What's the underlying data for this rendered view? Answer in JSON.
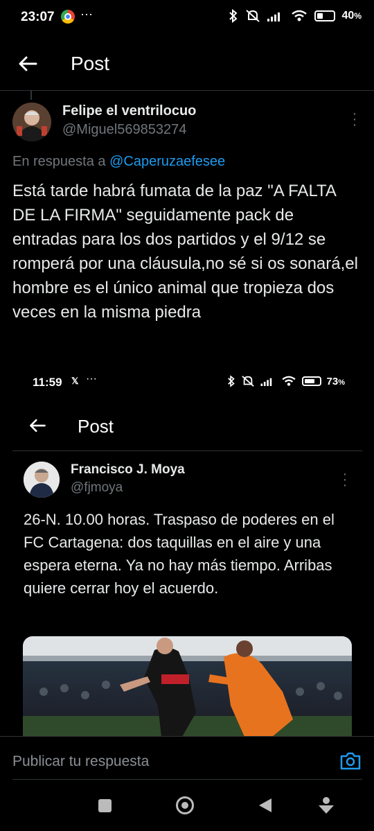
{
  "status_bar": {
    "time": "23:07",
    "battery": "40",
    "battery_fill": 0.4
  },
  "header": {
    "title": "Post"
  },
  "tweet": {
    "name": "Felipe el ventrilocuo",
    "handle": "@Miguel569853274",
    "reply_prefix": "En respuesta a",
    "reply_to": "@Caperuzaefesee",
    "text": "Está tarde habrá fumata de la paz \"A FALTA DE LA FIRMA\" seguidamente pack de entradas para los dos partidos y el 9/12 se romperá por una cláusula,no sé si os sonará,el hombre es el único animal que tropieza dos veces en la misma piedra"
  },
  "embedded_screenshot": {
    "status_bar": {
      "time": "11:59",
      "battery": "73",
      "battery_fill": 0.73
    },
    "header": {
      "title": "Post"
    },
    "tweet": {
      "name": "Francisco J. Moya",
      "handle": "@fjmoya",
      "text": "26-N. 10.00 horas. Traspaso de poderes en el FC Cartagena: dos taquillas en el aire y una espera eterna. Ya no hay más tiempo. Arribas quiere cerrar hoy el acuerdo."
    }
  },
  "reply_bar": {
    "placeholder": "Publicar tu respuesta"
  },
  "colors": {
    "accent": "#1d9bf0",
    "background": "#000000",
    "text": "#e7e9ea",
    "muted": "#71767b"
  }
}
